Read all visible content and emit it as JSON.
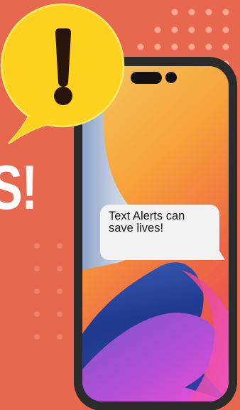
{
  "headline": {
    "visible_fragment": "S!"
  },
  "message_bubble": {
    "text": "Text Alerts can save lives!"
  },
  "icons": {
    "alert": "exclamation-mark-icon",
    "phone": "smartphone-icon"
  },
  "colors": {
    "background": "#e8674f",
    "alert_bubble_fill": "#ffd21f",
    "alert_mark": "#2a1410",
    "phone_frame": "#2b2b2b",
    "bubble_fill": "#f2f2f2",
    "wallpaper_orange": "#f7a23a",
    "wallpaper_blue": "#26449a",
    "wallpaper_magenta": "#e952d8"
  }
}
